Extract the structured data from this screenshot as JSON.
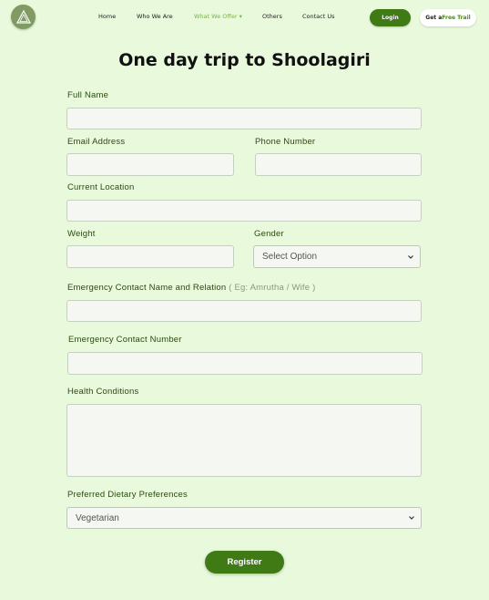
{
  "nav": {
    "items": [
      "Home",
      "Who We Are",
      "What We Offer",
      "Others",
      "Contact Us"
    ],
    "dropdown_arrow": "▾",
    "login": "Login",
    "trial_prefix": "Get a ",
    "trial_highlight": "Free Trail"
  },
  "form": {
    "title": "One day trip to Shoolagiri",
    "full_name_label": "Full Name",
    "email_label": "Email Address",
    "phone_label": "Phone Number",
    "location_label": "Current Location",
    "weight_label": "Weight",
    "gender_label": "Gender",
    "gender_value": "Select Option",
    "emergency_name_label": "Emergency Contact Name and Relation",
    "emergency_name_hint": "( Eg: Amrutha / Wife )",
    "emergency_number_label": "Emergency Contact Number",
    "health_label": "Health Conditions",
    "diet_label": "Preferred Dietary Preferences",
    "diet_value": "Vegetarian",
    "register": "Register"
  },
  "colors": {
    "background": "#e8f9dc",
    "accent": "#3f7a14",
    "nav_active": "#7cb14a"
  },
  "icons": [
    "logo-icon",
    "chevron-down-icon"
  ]
}
